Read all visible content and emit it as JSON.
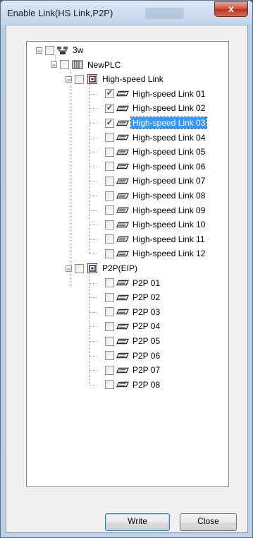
{
  "window": {
    "title": "Enable Link(HS Link,P2P)",
    "close_glyph": "x"
  },
  "tree": {
    "root": {
      "label": "3w",
      "icon": "network-icon",
      "expanded": true,
      "checked": false
    },
    "plc": {
      "label": "NewPLC",
      "icon": "plc-icon",
      "expanded": true,
      "checked": false
    },
    "groups": [
      {
        "label": "High-speed Link",
        "icon": "hs-link-icon",
        "accent": "#cc2222",
        "expanded": true,
        "checked": false,
        "items": [
          {
            "label": "High-speed Link 01",
            "checked": true,
            "selected": false
          },
          {
            "label": "High-speed Link 02",
            "checked": true,
            "selected": false
          },
          {
            "label": "High-speed Link 03",
            "checked": true,
            "selected": true
          },
          {
            "label": "High-speed Link 04",
            "checked": false,
            "selected": false
          },
          {
            "label": "High-speed Link 05",
            "checked": false,
            "selected": false
          },
          {
            "label": "High-speed Link 06",
            "checked": false,
            "selected": false
          },
          {
            "label": "High-speed Link 07",
            "checked": false,
            "selected": false
          },
          {
            "label": "High-speed Link 08",
            "checked": false,
            "selected": false
          },
          {
            "label": "High-speed Link 09",
            "checked": false,
            "selected": false
          },
          {
            "label": "High-speed Link 10",
            "checked": false,
            "selected": false
          },
          {
            "label": "High-speed Link 11",
            "checked": false,
            "selected": false
          },
          {
            "label": "High-speed Link 12",
            "checked": false,
            "selected": false
          }
        ]
      },
      {
        "label": "P2P(EIP)",
        "icon": "p2p-icon",
        "accent": "#2244cc",
        "expanded": true,
        "checked": false,
        "items": [
          {
            "label": "P2P 01",
            "checked": false,
            "selected": false
          },
          {
            "label": "P2P 02",
            "checked": false,
            "selected": false
          },
          {
            "label": "P2P 03",
            "checked": false,
            "selected": false
          },
          {
            "label": "P2P 04",
            "checked": false,
            "selected": false
          },
          {
            "label": "P2P 05",
            "checked": false,
            "selected": false
          },
          {
            "label": "P2P 06",
            "checked": false,
            "selected": false
          },
          {
            "label": "P2P 07",
            "checked": false,
            "selected": false
          },
          {
            "label": "P2P 08",
            "checked": false,
            "selected": false
          }
        ]
      }
    ]
  },
  "buttons": {
    "write_label": "Write",
    "close_label": "Close"
  },
  "colors": {
    "selection": "#3399ff",
    "check": "#1f3e7b"
  }
}
